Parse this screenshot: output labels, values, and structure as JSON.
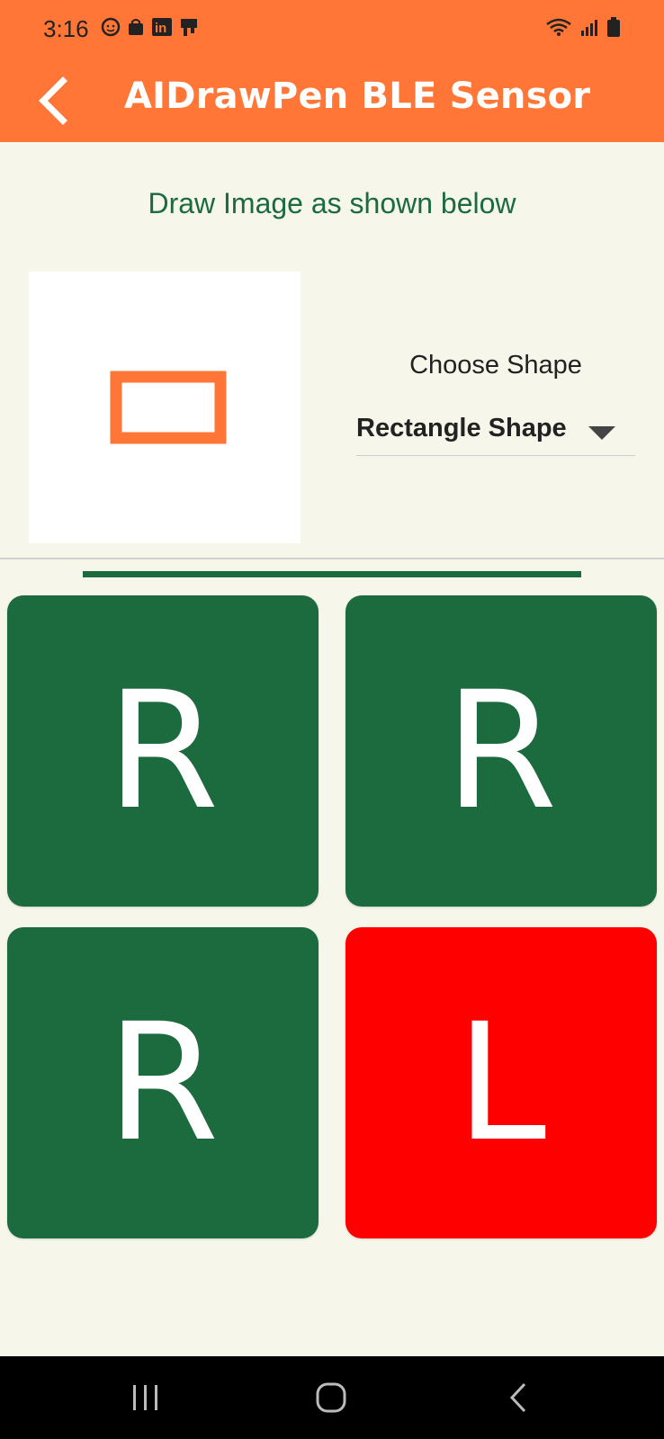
{
  "status_bar": {
    "time": "3:16",
    "left_icons": [
      "face-icon",
      "bag-icon",
      "linkedin-icon",
      "flag-icon"
    ],
    "right_icons": [
      "wifi-icon",
      "signal-icon",
      "battery-icon"
    ]
  },
  "app_bar": {
    "title": "AIDrawPen BLE Sensor",
    "back_icon": "chevron-left-icon",
    "color": "#ff7636"
  },
  "main": {
    "instruction": "Draw Image as shown below",
    "preview_shape": "rectangle",
    "preview_color": "#ff7636",
    "choose_label": "Choose Shape",
    "selected_shape": "Rectangle Shape"
  },
  "tiles": [
    {
      "letter": "R",
      "color": "#1b6b3e"
    },
    {
      "letter": "R",
      "color": "#1b6b3e"
    },
    {
      "letter": "R",
      "color": "#1b6b3e"
    },
    {
      "letter": "L",
      "color": "#ff0000"
    }
  ],
  "nav_bar": {
    "icons": [
      "recent-apps-icon",
      "home-icon",
      "back-icon"
    ]
  }
}
